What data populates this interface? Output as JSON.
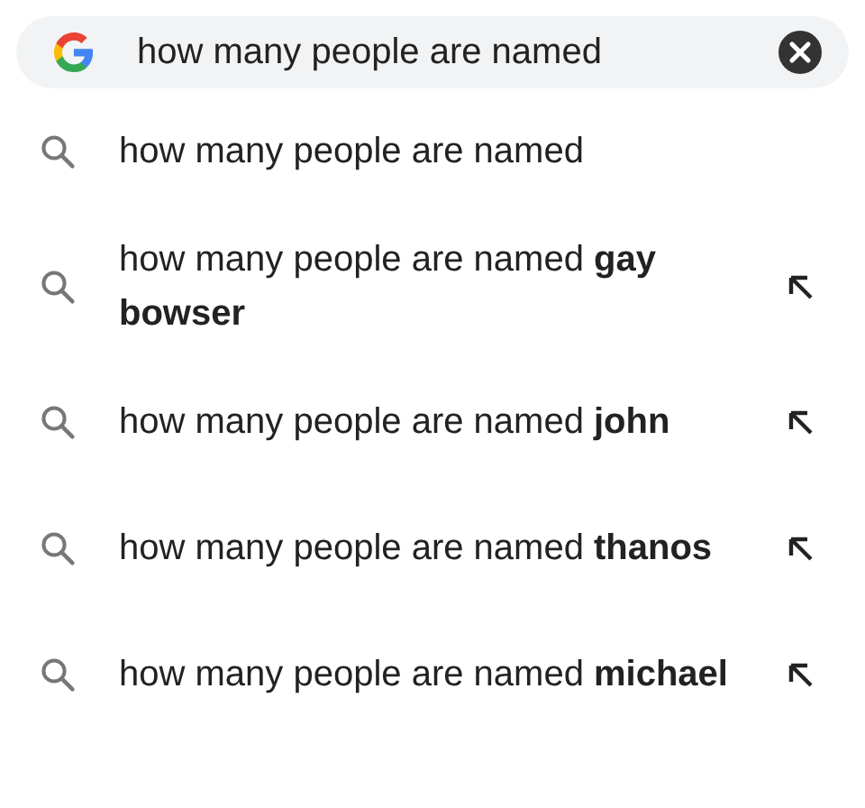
{
  "search": {
    "value": "how many people are named"
  },
  "suggestions": [
    {
      "text": "how many people are named",
      "fill_arrow": false
    },
    {
      "text": "how many people are named **gay bowser**",
      "fill_arrow": true
    },
    {
      "text": "how many people are named **john**",
      "fill_arrow": true
    },
    {
      "text": "how many people are named **thanos**",
      "fill_arrow": true
    },
    {
      "text": "how many people are named **michael**",
      "fill_arrow": true
    }
  ]
}
